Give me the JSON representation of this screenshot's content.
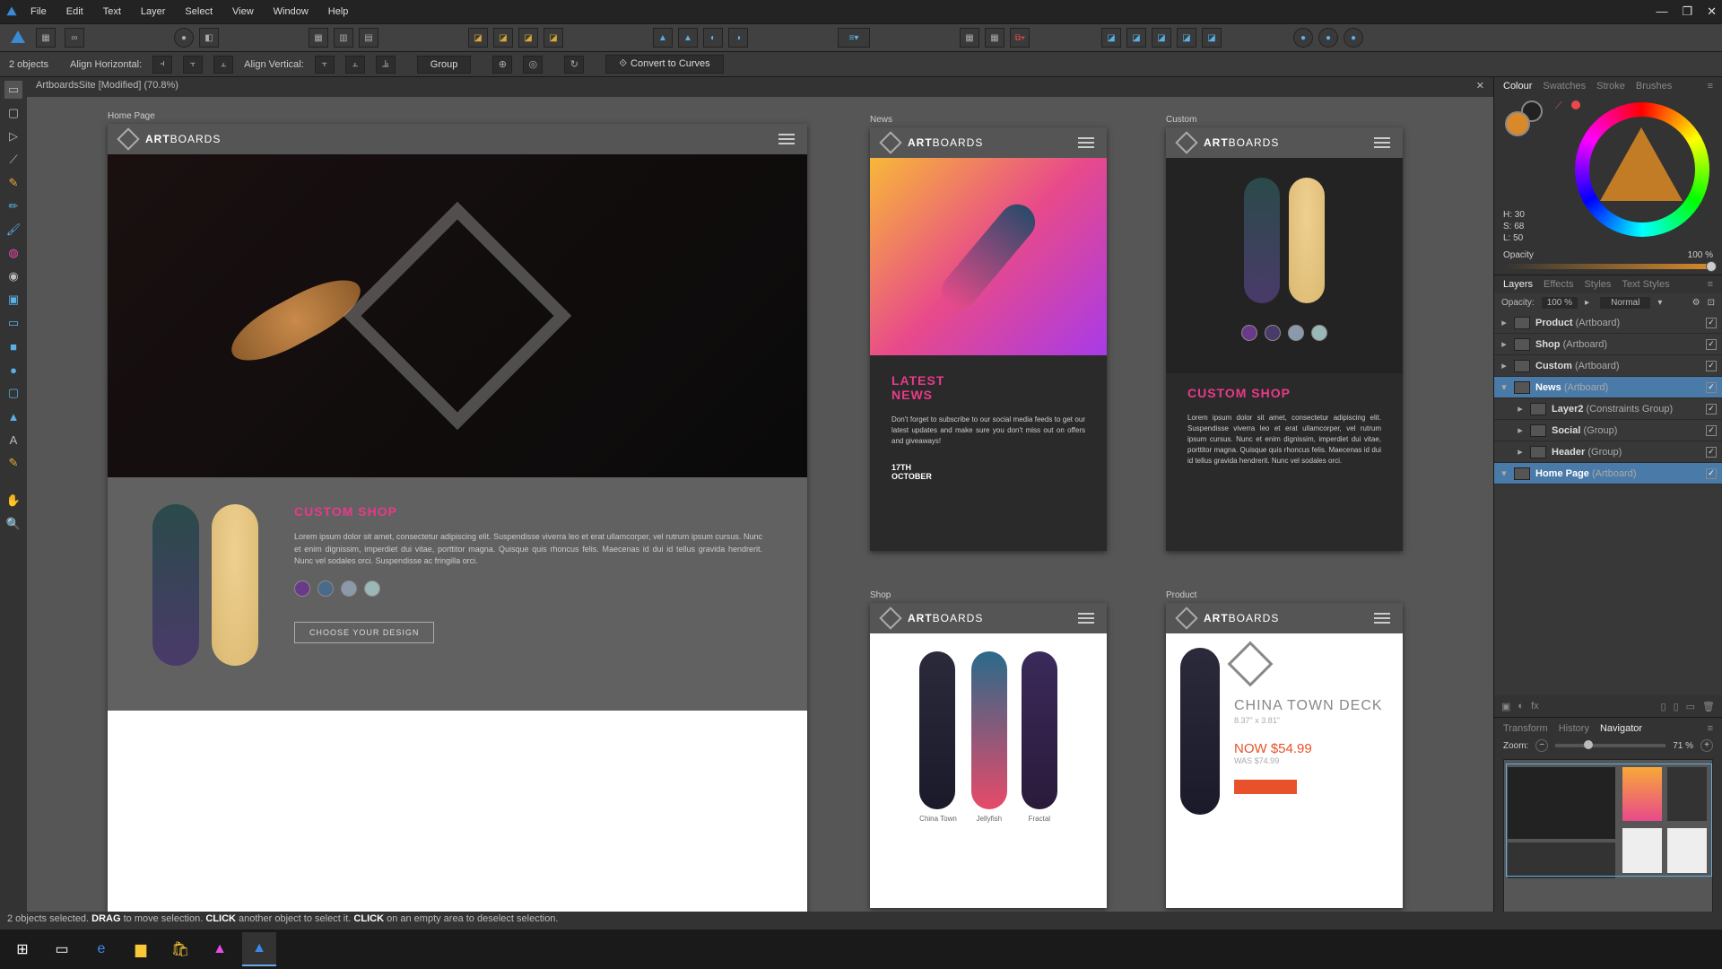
{
  "menu": [
    "File",
    "Edit",
    "Text",
    "Layer",
    "Select",
    "View",
    "Window",
    "Help"
  ],
  "document": {
    "tab": "ArtboardsSite [Modified] (70.8%)"
  },
  "context": {
    "objects": "2 objects",
    "alignH": "Align Horizontal:",
    "alignV": "Align Vertical:",
    "group": "Group",
    "convert": "Convert to Curves"
  },
  "artboards": {
    "home": {
      "label": "Home Page",
      "brand": "BOARDS",
      "customTitle": "CUSTOM SHOP",
      "lorem": "Lorem ipsum dolor sit amet, consectetur adipiscing elit. Suspendisse viverra leo et erat ullamcorper, vel rutrum ipsum cursus. Nunc et enim dignissim, imperdiet dui vitae, porttitor magna. Quisque quis rhoncus felis. Maecenas id dui id tellus gravida hendrerit. Nunc vel sodales orci. Suspendisse ac fringilla orci.",
      "choose": "CHOOSE YOUR DESIGN"
    },
    "news": {
      "label": "News",
      "title": "LATEST\nNEWS",
      "body": "Don't forget to subscribe to our social media feeds to get our latest updates and make sure you don't miss out on offers and giveaways!",
      "date": "17TH\nOCTOBER"
    },
    "custom": {
      "label": "Custom",
      "title": "CUSTOM SHOP",
      "lorem": "Lorem ipsum dolor sit amet, consectetur adipiscing elit. Suspendisse viverra leo et erat ullamcorper, vel rutrum ipsum cursus. Nunc et enim dignissim, imperdiet dui vitae, porttitor magna. Quisque quis rhoncus felis. Maecenas id dui id tellus gravida hendrerit. Nunc vel sodales orci."
    },
    "shop": {
      "label": "Shop",
      "items": [
        "China Town",
        "Jellyfish",
        "Fractal"
      ]
    },
    "product": {
      "label": "Product",
      "name": "CHINA TOWN DECK",
      "dims": "8.37\" x 3.81\"",
      "now": "NOW $54.99",
      "was": "WAS $74.99"
    }
  },
  "panels": {
    "colorTabs": [
      "Colour",
      "Swatches",
      "Stroke",
      "Brushes"
    ],
    "hsl": {
      "h": "H: 30",
      "s": "S: 68",
      "l": "L: 50"
    },
    "opacityLabel": "Opacity",
    "opacityVal": "100 %",
    "layerTabs": [
      "Layers",
      "Effects",
      "Styles",
      "Text Styles"
    ],
    "layerOpacity": "Opacity:",
    "layerOpVal": "100 %",
    "blend": "Normal",
    "layers": [
      {
        "name": "Product",
        "type": "(Artboard)",
        "sel": false,
        "indent": 0,
        "open": false
      },
      {
        "name": "Shop",
        "type": "(Artboard)",
        "sel": false,
        "indent": 0,
        "open": false
      },
      {
        "name": "Custom",
        "type": "(Artboard)",
        "sel": false,
        "indent": 0,
        "open": false
      },
      {
        "name": "News",
        "type": "(Artboard)",
        "sel": true,
        "indent": 0,
        "open": true
      },
      {
        "name": "Layer2",
        "type": "(Constraints Group)",
        "sel": false,
        "indent": 1,
        "open": false
      },
      {
        "name": "Social",
        "type": "(Group)",
        "sel": false,
        "indent": 1,
        "open": false
      },
      {
        "name": "Header",
        "type": "(Group)",
        "sel": false,
        "indent": 1,
        "open": false
      },
      {
        "name": "Home Page",
        "type": "(Artboard)",
        "sel": true,
        "indent": 0,
        "open": true
      }
    ],
    "navTabs": [
      "Transform",
      "History",
      "Navigator"
    ],
    "zoomLabel": "Zoom:",
    "zoomVal": "71 %"
  },
  "status": {
    "pre": "2 objects selected. ",
    "d": "DRAG",
    "mid": " to move selection. ",
    "c": "CLICK",
    "mid2": " another object to select it. ",
    "c2": "CLICK",
    "end": " on an empty area to deselect selection."
  }
}
